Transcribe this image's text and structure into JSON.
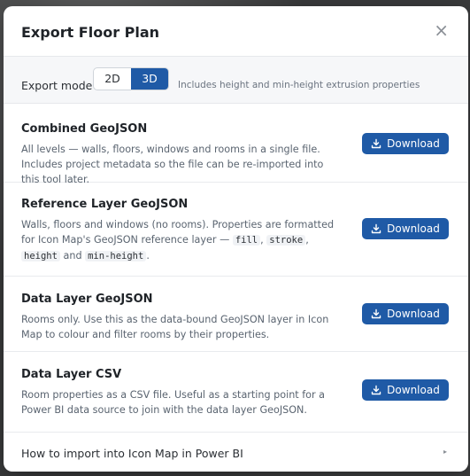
{
  "dialog": {
    "title": "Export Floor Plan",
    "close_icon": "×"
  },
  "export_mode": {
    "label": "Export mode",
    "options": [
      "2D",
      "3D"
    ],
    "selected": "3D",
    "hint": "Includes height and min-height extrusion properties"
  },
  "sections": [
    {
      "title": "Combined GeoJSON",
      "description": "All levels — walls, floors, windows and rooms in a single file. Includes project metadata so the file can be re-imported into this tool later.",
      "button": "Download"
    },
    {
      "title": "Reference Layer GeoJSON",
      "description_before": "Walls, floors and windows (no rooms). Properties are formatted for Icon Map's GeoJSON reference layer — ",
      "codes": [
        "fill",
        "stroke",
        "height",
        "min-height"
      ],
      "separators": [
        ", ",
        ", ",
        " and "
      ],
      "description_after": ".",
      "button": "Download"
    },
    {
      "title": "Data Layer GeoJSON",
      "description": "Rooms only. Use this as the data-bound GeoJSON layer in Icon Map to colour and filter rooms by their properties.",
      "button": "Download"
    },
    {
      "title": "Data Layer CSV",
      "description": "Room properties as a CSV file. Useful as a starting point for a Power BI data source to join with the data layer GeoJSON.",
      "button": "Download"
    }
  ],
  "footer": {
    "label": "How to import into Icon Map in Power BI",
    "chevron_icon": "▸"
  },
  "colors": {
    "accent": "#1f5aa6"
  }
}
